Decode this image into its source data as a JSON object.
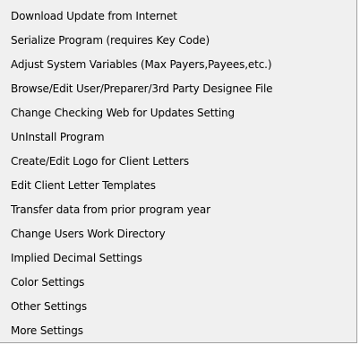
{
  "menu": {
    "items": [
      {
        "label": "Download Update from Internet"
      },
      {
        "label": "Serialize Program (requires Key Code)"
      },
      {
        "label": "Adjust System Variables (Max Payers,Payees,etc.)"
      },
      {
        "label": "Browse/Edit User/Preparer/3rd Party Designee File"
      },
      {
        "label": "Change Checking Web for Updates Setting"
      },
      {
        "label": "UnInstall Program"
      },
      {
        "label": "Create/Edit Logo for Client Letters"
      },
      {
        "label": "Edit Client Letter Templates"
      },
      {
        "label": "Transfer data from prior program year"
      },
      {
        "label": "Change Users Work Directory"
      },
      {
        "label": "Implied Decimal Settings"
      },
      {
        "label": "Color Settings"
      },
      {
        "label": "Other Settings"
      },
      {
        "label": "More Settings"
      }
    ]
  }
}
